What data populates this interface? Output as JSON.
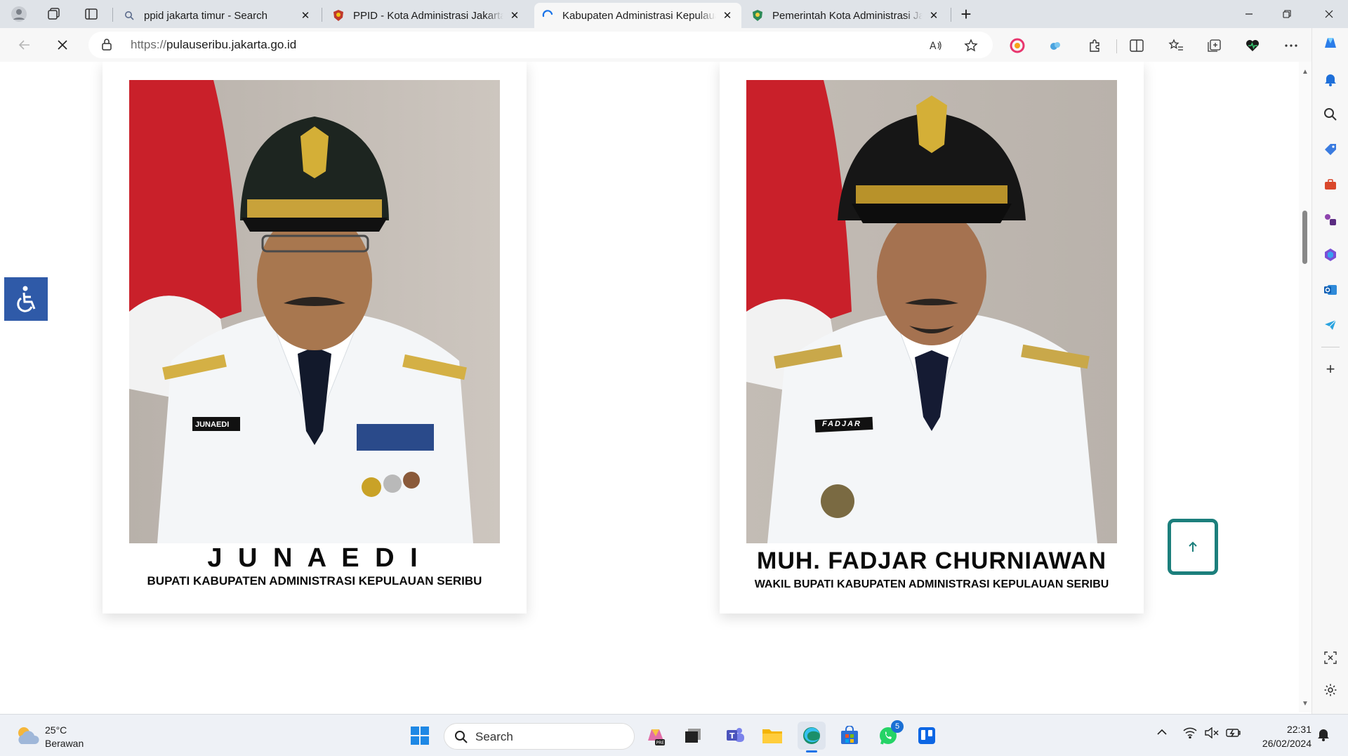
{
  "browser": {
    "tabs": [
      {
        "title": "ppid jakarta timur - Search",
        "favicon": "search-icon",
        "active": false
      },
      {
        "title": "PPID - Kota Administrasi Jakarta Timur",
        "favicon": "ppid-logo-icon",
        "active": false
      },
      {
        "title": "Kabupaten Administrasi Kepulauan Seribu",
        "favicon": "loading-spinner-icon",
        "active": true
      },
      {
        "title": "Pemerintah Kota Administrasi Jakarta Timur",
        "favicon": "jaktim-logo-icon",
        "active": false
      }
    ],
    "address": {
      "protocol": "https://",
      "host": "pulauseribu.jakarta.go.id"
    }
  },
  "page": {
    "officials": [
      {
        "name": "J U N A E D I",
        "title": "BUPATI KABUPATEN ADMINISTRASI KEPULAUAN SERIBU",
        "badge": "JUNAEDI"
      },
      {
        "name": "MUH. FADJAR CHURNIAWAN",
        "title": "WAKIL BUPATI KABUPATEN ADMINISTRASI KEPULAUAN SERIBU",
        "badge": "FADJAR"
      }
    ]
  },
  "taskbar": {
    "weather": {
      "temp": "25°C",
      "desc": "Berawan"
    },
    "search_label": "Search",
    "whatsapp_badge": "5",
    "clock": {
      "time": "22:31",
      "date": "26/02/2024"
    }
  },
  "colors": {
    "accessibility_button": "#2f5aa8",
    "back_to_top_border": "#1c7f7c",
    "flag_red": "#d2202a"
  }
}
